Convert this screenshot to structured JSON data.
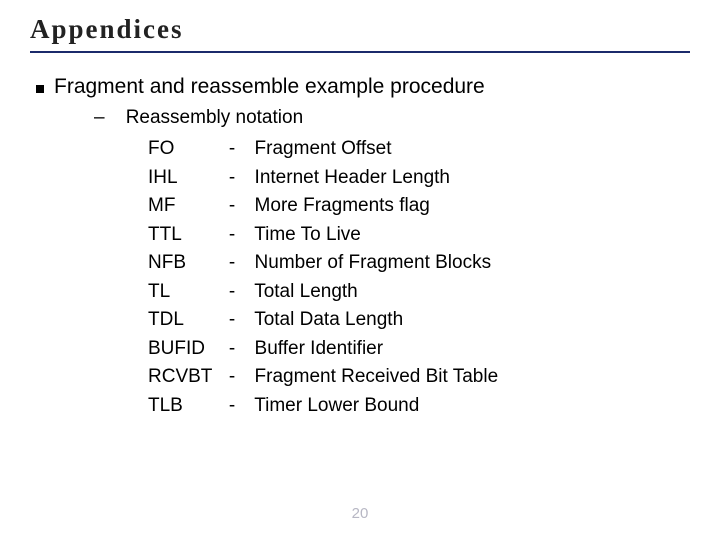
{
  "title": "Appendices",
  "section_heading": "Fragment and reassemble example procedure",
  "sub_heading_prefix": "–",
  "sub_heading": "Reassembly notation",
  "separator": "-",
  "definitions": [
    {
      "abbr": "FO",
      "desc": "Fragment Offset"
    },
    {
      "abbr": "IHL",
      "desc": "Internet Header Length"
    },
    {
      "abbr": "MF",
      "desc": "More Fragments flag"
    },
    {
      "abbr": "TTL",
      "desc": "Time To Live"
    },
    {
      "abbr": "NFB",
      "desc": "Number of Fragment Blocks"
    },
    {
      "abbr": "TL",
      "desc": "Total Length"
    },
    {
      "abbr": "TDL",
      "desc": "Total Data Length"
    },
    {
      "abbr": "BUFID",
      "desc": "Buffer Identifier"
    },
    {
      "abbr": "RCVBT",
      "desc": "Fragment Received Bit Table"
    },
    {
      "abbr": "TLB",
      "desc": "Timer Lower Bound"
    }
  ],
  "page_number": "20"
}
